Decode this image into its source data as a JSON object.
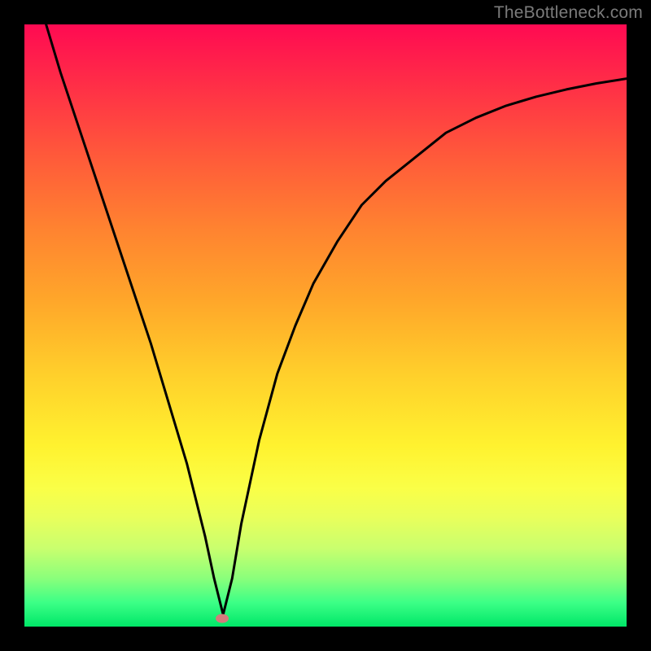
{
  "watermark": "TheBottleneck.com",
  "chart_data": {
    "type": "line",
    "title": "",
    "xlabel": "",
    "ylabel": "",
    "xlim": [
      0,
      100
    ],
    "ylim": [
      0,
      100
    ],
    "grid": false,
    "legend": false,
    "series": [
      {
        "name": "curve",
        "x": [
          3,
          6,
          9,
          12,
          15,
          18,
          21,
          24,
          27,
          30,
          31.5,
          33,
          34.5,
          36,
          39,
          42,
          45,
          48,
          52,
          56,
          60,
          65,
          70,
          75,
          80,
          85,
          90,
          95,
          100
        ],
        "y": [
          102,
          92,
          83,
          74,
          65,
          56,
          47,
          37,
          27,
          15,
          8,
          2,
          8,
          17,
          31,
          42,
          50,
          57,
          64,
          70,
          74,
          78,
          82,
          84.5,
          86.5,
          88,
          89.2,
          90.2,
          91
        ]
      }
    ],
    "marker": {
      "x": 32.8,
      "y": 1.3,
      "color": "#d47b7c"
    },
    "gradient_stops": [
      {
        "pct": 0,
        "color": "#ff0a52"
      },
      {
        "pct": 10,
        "color": "#ff2e47"
      },
      {
        "pct": 22,
        "color": "#ff5a3a"
      },
      {
        "pct": 34,
        "color": "#ff8330"
      },
      {
        "pct": 46,
        "color": "#ffa72a"
      },
      {
        "pct": 58,
        "color": "#ffcf2b"
      },
      {
        "pct": 70,
        "color": "#fff22f"
      },
      {
        "pct": 77,
        "color": "#faff47"
      },
      {
        "pct": 82,
        "color": "#e8ff5c"
      },
      {
        "pct": 87,
        "color": "#c9ff6e"
      },
      {
        "pct": 92,
        "color": "#8aff7b"
      },
      {
        "pct": 96,
        "color": "#3cff86"
      },
      {
        "pct": 100,
        "color": "#00e768"
      }
    ]
  }
}
